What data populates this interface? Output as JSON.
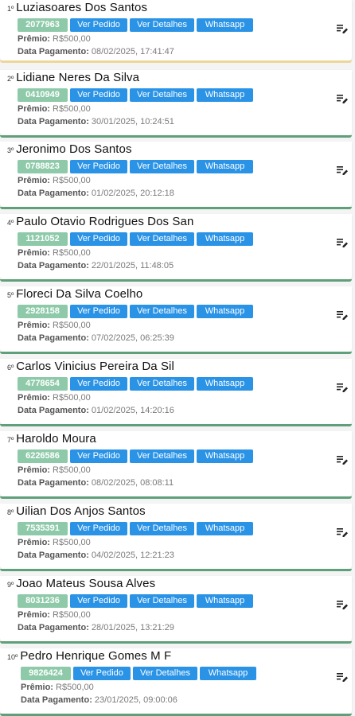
{
  "labels": {
    "ver_pedido": "Ver Pedido",
    "ver_detalhes": "Ver Detalhes",
    "whatsapp": "Whatsapp",
    "premio": "Prêmio:",
    "data_pagamento": "Data Pagamento:"
  },
  "winners": [
    {
      "rank": "1º",
      "name": "Luziasoares Dos Santos",
      "code": "2077963",
      "prize": "R$500,00",
      "date": "08/02/2025, 17:41:47"
    },
    {
      "rank": "2º",
      "name": "Lidiane Neres Da Silva",
      "code": "0410949",
      "prize": "R$500,00",
      "date": "30/01/2025, 10:24:51"
    },
    {
      "rank": "3º",
      "name": "Jeronimo Dos Santos",
      "code": "0788823",
      "prize": "R$500,00",
      "date": "01/02/2025, 20:12:18"
    },
    {
      "rank": "4º",
      "name": "Paulo Otavio Rodrigues Dos San",
      "code": "1121052",
      "prize": "R$500,00",
      "date": "22/01/2025, 11:48:05"
    },
    {
      "rank": "5º",
      "name": "Floreci Da Silva Coelho",
      "code": "2928158",
      "prize": "R$500,00",
      "date": "07/02/2025, 06:25:39"
    },
    {
      "rank": "6º",
      "name": "Carlos Vinicius Pereira Da Sil",
      "code": "4778654",
      "prize": "R$500,00",
      "date": "01/02/2025, 14:20:16"
    },
    {
      "rank": "7º",
      "name": "Haroldo Moura",
      "code": "6226586",
      "prize": "R$500,00",
      "date": "08/02/2025, 08:08:11"
    },
    {
      "rank": "8º",
      "name": "Uilian Dos Anjos Santos",
      "code": "7535391",
      "prize": "R$500,00",
      "date": "04/02/2025, 12:21:23"
    },
    {
      "rank": "9º",
      "name": "Joao Mateus Sousa Alves",
      "code": "8031236",
      "prize": "R$500,00",
      "date": "28/01/2025, 13:21:29"
    },
    {
      "rank": "10º",
      "name": "Pedro Henrique Gomes M F",
      "code": "9826424",
      "prize": "R$500,00",
      "date": "23/01/2025, 09:00:06"
    }
  ],
  "icons": {
    "edit": "edit-note-icon"
  },
  "colors": {
    "code_badge": "#8ecaa9",
    "button": "#2a93e6",
    "card_accent": "#5f9f79",
    "first_accent": "#ecd79a"
  }
}
